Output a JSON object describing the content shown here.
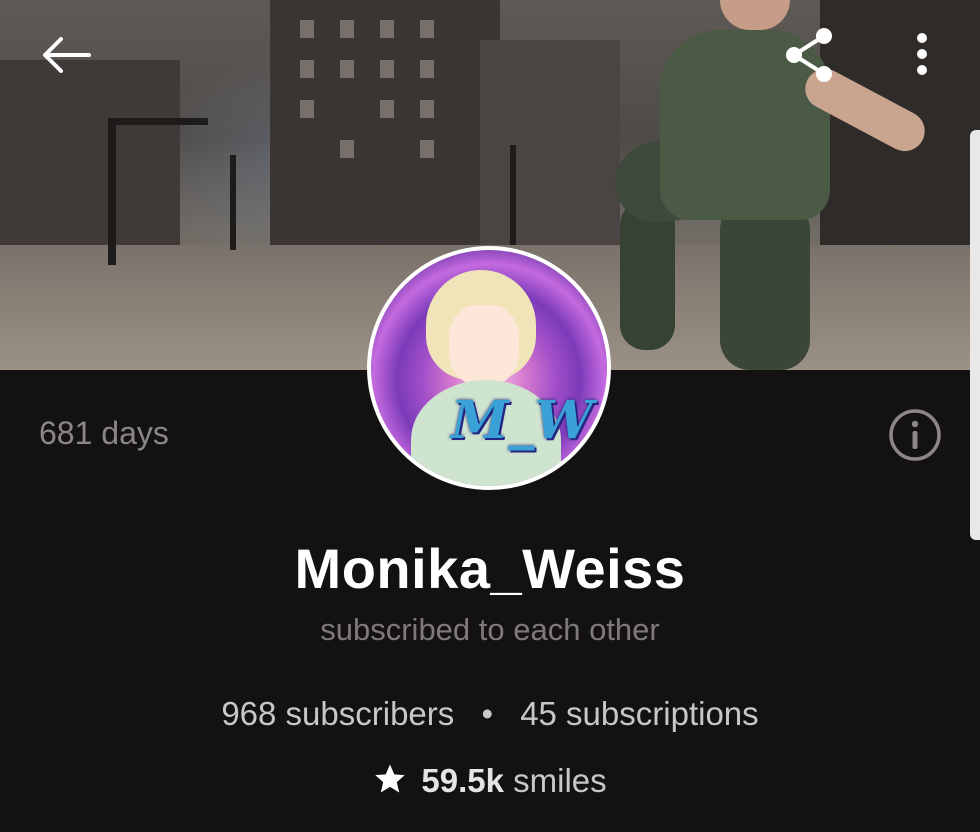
{
  "profile": {
    "username": "Monika_Weiss",
    "relationship": "subscribed to each other",
    "days_label": "681 days",
    "subscribers_label": "968 subscribers",
    "separator": "•",
    "subscriptions_label": "45 subscriptions",
    "smiles_count": "59.5k",
    "smiles_label": "smiles",
    "avatar_text": "M_W"
  },
  "icons": {
    "back": "arrow-left-icon",
    "share": "share-icon",
    "more": "more-vertical-icon",
    "info": "info-icon",
    "star": "star-icon"
  },
  "colors": {
    "background": "#131111",
    "primary_text": "#ffffff",
    "muted_text": "#7d7a79",
    "stats_text": "#c9c7c6"
  }
}
